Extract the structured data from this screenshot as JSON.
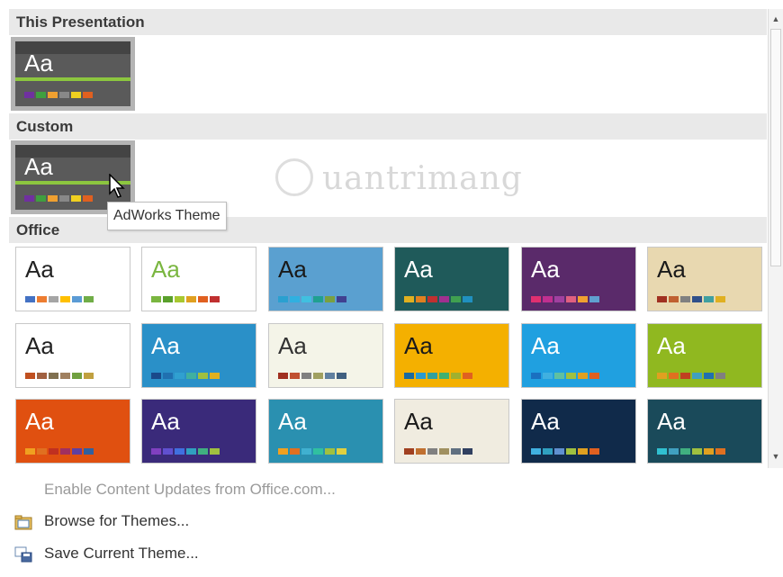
{
  "sections": {
    "this_presentation": "This Presentation",
    "custom": "Custom",
    "office": "Office"
  },
  "theme_glyph": "Aa",
  "tooltip": "AdWorks Theme",
  "custom_theme_swatches": [
    "#7030a0",
    "#3f9f3f",
    "#f0a030",
    "#888888",
    "#f0d020",
    "#e06020"
  ],
  "office_themes": [
    {
      "bg": "#ffffff",
      "fg": "#222222",
      "swatches": [
        "#4472c4",
        "#ed7d31",
        "#a5a5a5",
        "#ffc000",
        "#5b9bd5",
        "#70ad47"
      ]
    },
    {
      "bg": "#ffffff",
      "fg": "#7ab640",
      "swatches": [
        "#7ab640",
        "#5aa02c",
        "#a8c830",
        "#e0a020",
        "#e06020",
        "#c03030"
      ]
    },
    {
      "bg": "#5aa0d0",
      "fg": "#1a1a1a",
      "swatches": [
        "#2aa0d0",
        "#30b0e0",
        "#40c0e0",
        "#20a090",
        "#7aa040",
        "#404090"
      ]
    },
    {
      "bg": "#1f5a5a",
      "fg": "#ffffff",
      "swatches": [
        "#e0b020",
        "#e08020",
        "#c03030",
        "#a03090",
        "#40a050",
        "#2090c0"
      ]
    },
    {
      "bg": "#5a2a6a",
      "fg": "#ffffff",
      "swatches": [
        "#e03070",
        "#c03090",
        "#a040a0",
        "#e06080",
        "#f0a030",
        "#60a0d0"
      ]
    },
    {
      "bg": "#e8d8b0",
      "fg": "#1a1a1a",
      "swatches": [
        "#a03020",
        "#c06030",
        "#808080",
        "#30508a",
        "#40a0a0",
        "#e0b020"
      ]
    },
    {
      "bg": "#ffffff",
      "fg": "#222222",
      "swatches": [
        "#c05020",
        "#a06040",
        "#807050",
        "#a08060",
        "#70a040",
        "#c0a040"
      ]
    },
    {
      "bg": "#2a90c8",
      "fg": "#ffffff",
      "swatches": [
        "#1a4a8a",
        "#2070b0",
        "#30a0d0",
        "#40b0a0",
        "#a0c040",
        "#e0b020"
      ]
    },
    {
      "bg": "#f4f4e8",
      "fg": "#333333",
      "swatches": [
        "#a03020",
        "#c05030",
        "#808080",
        "#a0a060",
        "#6080a0",
        "#406080"
      ]
    },
    {
      "bg": "#f4b000",
      "fg": "#1a1a1a",
      "swatches": [
        "#1a6aa0",
        "#2a9ad0",
        "#30a0a0",
        "#40b070",
        "#a0b030",
        "#e06020"
      ]
    },
    {
      "bg": "#20a0e0",
      "fg": "#ffffff",
      "swatches": [
        "#1a70c0",
        "#40b0e0",
        "#60c0a0",
        "#a0c040",
        "#e0a020",
        "#e06020"
      ]
    },
    {
      "bg": "#90b820",
      "fg": "#ffffff",
      "swatches": [
        "#e0a020",
        "#e07020",
        "#c04020",
        "#40a0c0",
        "#2070b0",
        "#808080"
      ]
    },
    {
      "bg": "#e05010",
      "fg": "#ffffff",
      "swatches": [
        "#f0a020",
        "#e07020",
        "#c03020",
        "#a03060",
        "#6040a0",
        "#3060a0"
      ]
    },
    {
      "bg": "#3a2a7a",
      "fg": "#ffffff",
      "swatches": [
        "#8040c0",
        "#6050d0",
        "#4070e0",
        "#30a0c0",
        "#40b080",
        "#a0c040"
      ]
    },
    {
      "bg": "#2a90b0",
      "fg": "#ffffff",
      "swatches": [
        "#f0a020",
        "#e07020",
        "#40b0d0",
        "#30c0a0",
        "#a0c040",
        "#e0d040"
      ]
    },
    {
      "bg": "#f0ece0",
      "fg": "#1a1a1a",
      "swatches": [
        "#a04020",
        "#c07030",
        "#808080",
        "#a09060",
        "#607080",
        "#304060"
      ]
    },
    {
      "bg": "#102a4a",
      "fg": "#ffffff",
      "swatches": [
        "#40b0e0",
        "#30a0c0",
        "#6090d0",
        "#a0c040",
        "#e0a020",
        "#e06020"
      ]
    },
    {
      "bg": "#1a4a5a",
      "fg": "#ffffff",
      "swatches": [
        "#30c0d0",
        "#40a0c0",
        "#40b080",
        "#a0c040",
        "#e0a020",
        "#e07020"
      ]
    }
  ],
  "menu": {
    "enable_updates": "Enable Content Updates from Office.com...",
    "browse": "Browse for Themes...",
    "save": "Save Current Theme..."
  },
  "watermark": "uantrimang"
}
